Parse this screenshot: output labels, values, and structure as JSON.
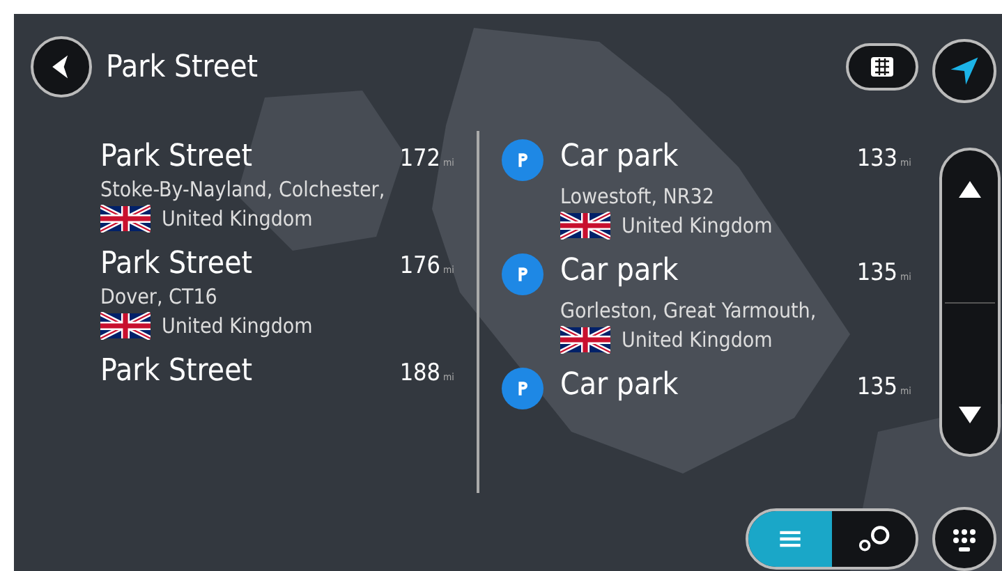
{
  "header": {
    "title": "Park Street"
  },
  "addresses": [
    {
      "name": "Park Street",
      "distance": "172",
      "unit": "mi",
      "area": "Stoke-By-Nayland, Colchester,",
      "country": "United Kingdom"
    },
    {
      "name": "Park Street",
      "distance": "176",
      "unit": "mi",
      "area": "Dover, CT16",
      "country": "United Kingdom"
    },
    {
      "name": "Park Street",
      "distance": "188",
      "unit": "mi"
    }
  ],
  "places": [
    {
      "name": "Car park",
      "distance": "133",
      "unit": "mi",
      "area": "Lowestoft, NR32",
      "country": "United Kingdom"
    },
    {
      "name": "Car park",
      "distance": "135",
      "unit": "mi",
      "area": "Gorleston, Great Yarmouth,",
      "country": "United Kingdom"
    },
    {
      "name": "Car park",
      "distance": "135",
      "unit": "mi"
    }
  ],
  "view_toggle": [
    {
      "kind": "list",
      "selected": true
    },
    {
      "kind": "map",
      "selected": false
    }
  ]
}
